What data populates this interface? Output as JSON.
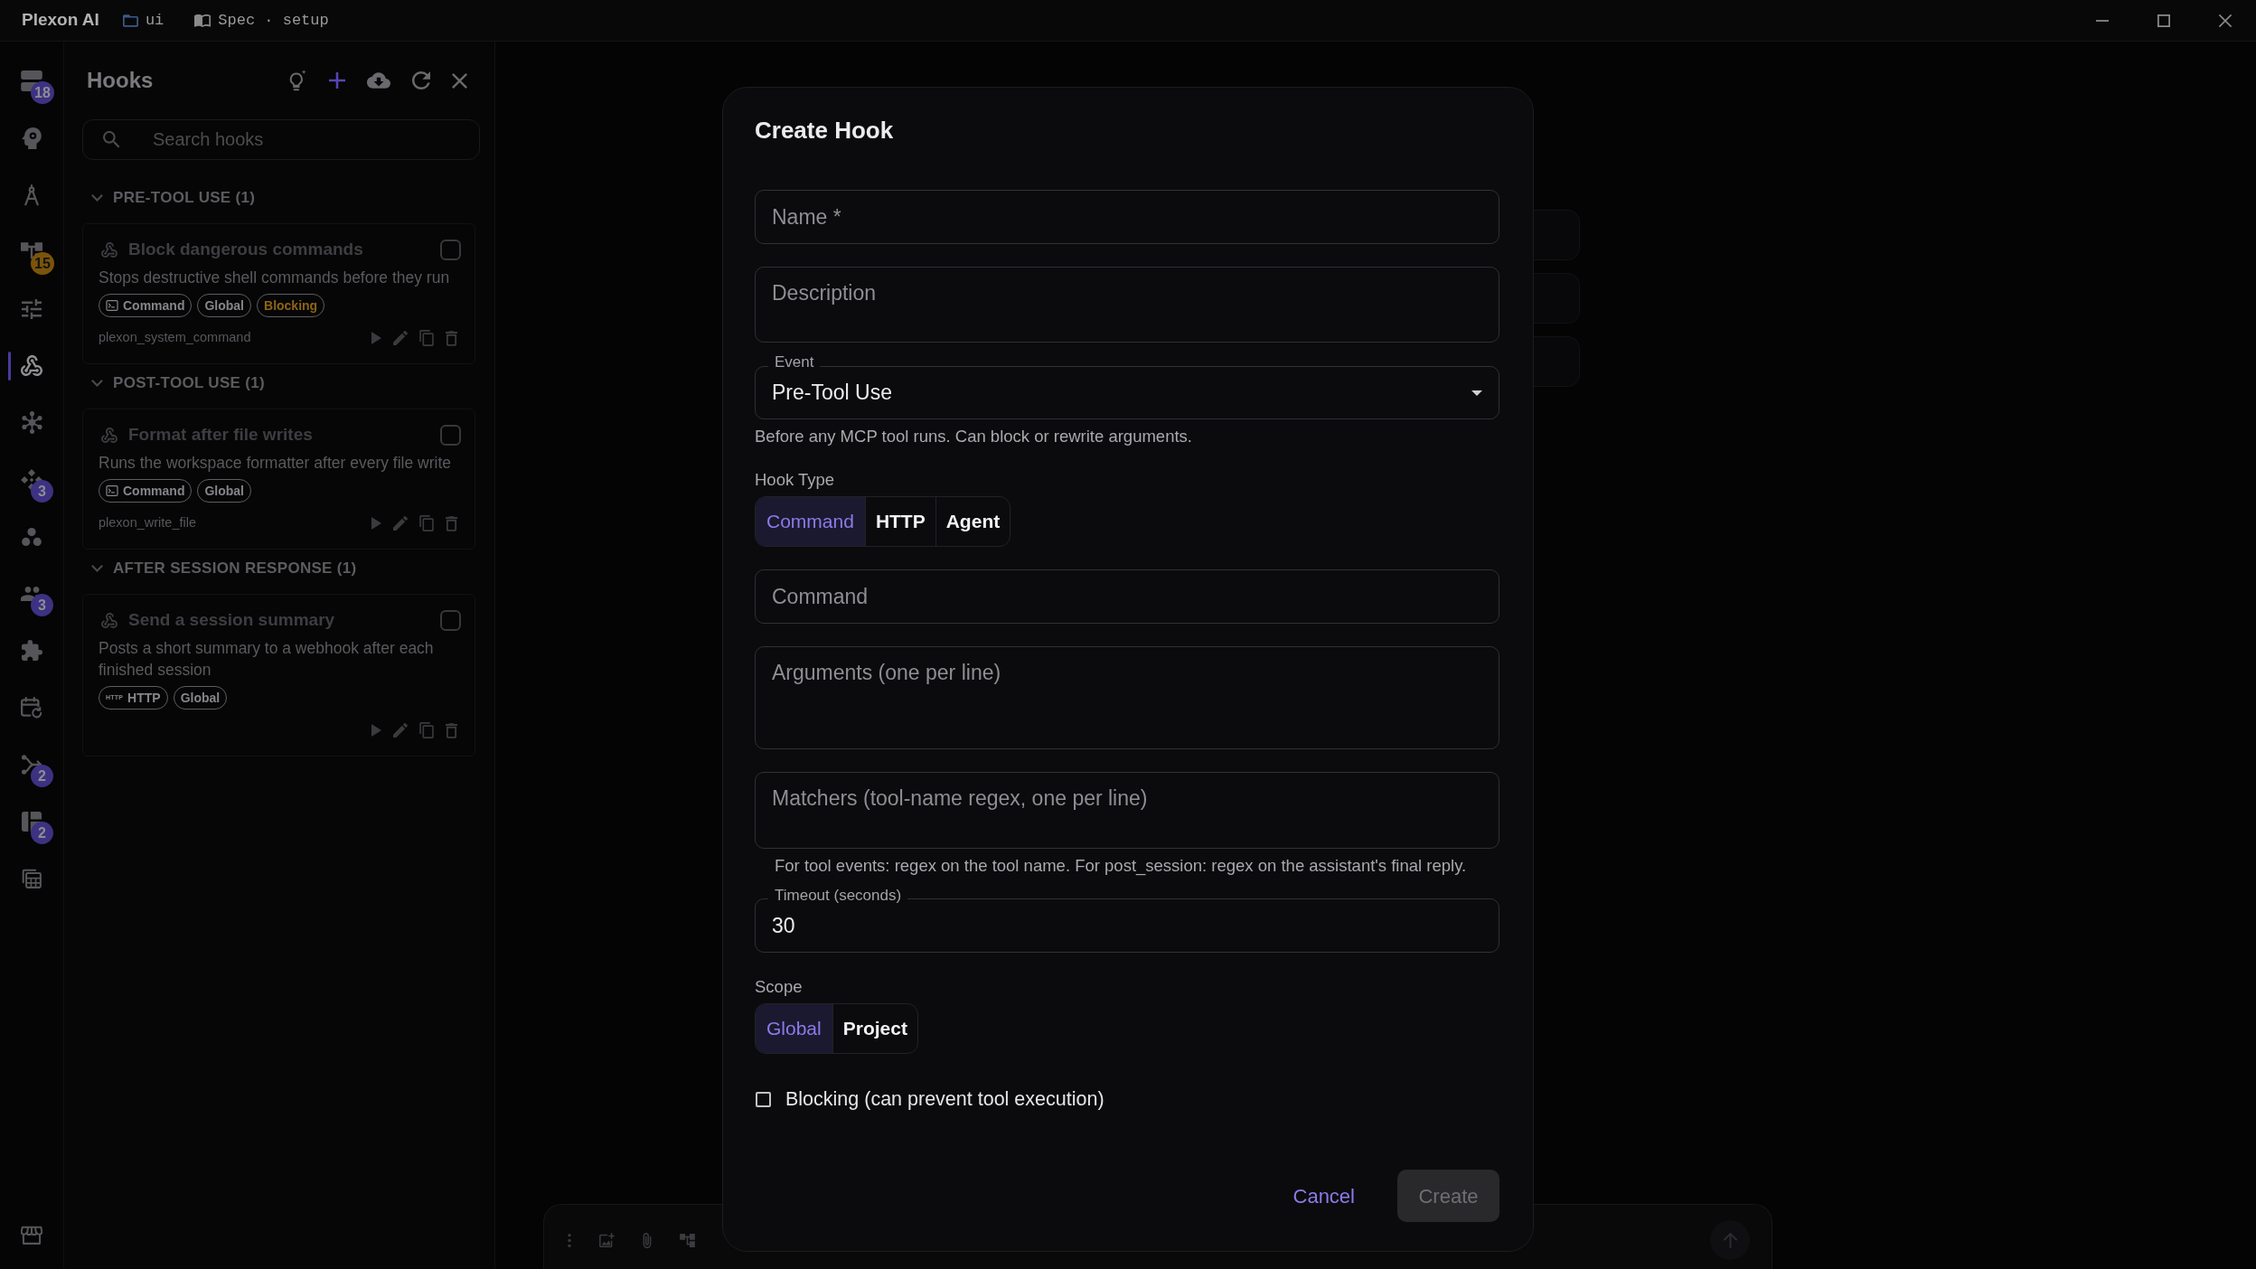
{
  "title_bar": {
    "app_name": "Plexon AI",
    "workspace": "ui",
    "document": "Spec · setup"
  },
  "rail": {
    "items": [
      {
        "selected": false,
        "badge": {
          "text": "18",
          "color": "#3d3182"
        }
      },
      {
        "selected": false
      },
      {
        "selected": false
      },
      {
        "selected": false,
        "badge": {
          "text": "15",
          "color": "#7b5409"
        }
      },
      {
        "selected": false
      },
      {
        "selected": true
      },
      {
        "selected": false
      },
      {
        "selected": false,
        "badge": {
          "text": "3",
          "color": "#3d3182"
        }
      },
      {
        "selected": false
      },
      {
        "selected": false,
        "badge": {
          "text": "3",
          "color": "#3d3182"
        }
      },
      {
        "selected": false
      },
      {
        "selected": false
      },
      {
        "selected": false,
        "badge": {
          "text": "2",
          "color": "#3d3182"
        }
      },
      {
        "selected": false,
        "badge": {
          "text": "2",
          "color": "#3d3182"
        }
      },
      {
        "selected": false
      }
    ],
    "footer_items": [
      {
        "selected": false
      }
    ]
  },
  "hooks_panel": {
    "title": "Hooks",
    "search": {
      "placeholder": "Search hooks"
    },
    "groups": [
      {
        "title": "PRE-TOOL USE (1)",
        "expanded": true,
        "hooks": [
          {
            "name": "Block dangerous commands",
            "enabled": false,
            "description": "Stops destructive shell commands before they run",
            "tags": [
              {
                "kind": "command",
                "label": "Command"
              },
              {
                "kind": "scope",
                "label": "Global"
              },
              {
                "kind": "blocking",
                "label": "Blocking"
              }
            ],
            "tool": "plexon_system_command"
          }
        ]
      },
      {
        "title": "POST-TOOL USE (1)",
        "expanded": true,
        "hooks": [
          {
            "name": "Format after file writes",
            "enabled": false,
            "description": "Runs the workspace formatter after every file write",
            "tags": [
              {
                "kind": "command",
                "label": "Command"
              },
              {
                "kind": "scope",
                "label": "Global"
              }
            ],
            "tool": "plexon_write_file"
          }
        ]
      },
      {
        "title": "AFTER SESSION RESPONSE (1)",
        "expanded": true,
        "hooks": [
          {
            "name": "Send a session summary",
            "enabled": false,
            "description": "Posts a short summary to a webhook after each finished session",
            "tags": [
              {
                "kind": "http",
                "label": "HTTP",
                "glyph": "HTTP"
              },
              {
                "kind": "scope",
                "label": "Global"
              }
            ]
          }
        ]
      }
    ]
  },
  "dialog": {
    "title": "Create Hook",
    "fields": [
      {
        "kind": "input",
        "placeholder": "Name *"
      },
      {
        "kind": "textarea",
        "placeholder": "Description"
      },
      {
        "kind": "select",
        "label": "Event",
        "value": "Pre-Tool Use",
        "helper": "Before any MCP tool runs. Can block or rewrite arguments."
      },
      {
        "kind": "segmented",
        "label": "Hook Type",
        "options": [
          {
            "label": "Command",
            "selected": true
          },
          {
            "label": "HTTP",
            "selected": false
          },
          {
            "label": "Agent",
            "selected": false
          }
        ]
      },
      {
        "kind": "input",
        "placeholder": "Command"
      },
      {
        "kind": "textarea",
        "placeholder": "Arguments (one per line)"
      },
      {
        "kind": "textarea",
        "placeholder": "Matchers (tool-name regex, one per line)",
        "helper": "For tool events: regex on the tool name. For post_session: regex on the assistant's final reply."
      },
      {
        "kind": "number",
        "label": "Timeout (seconds)",
        "value": "30"
      },
      {
        "kind": "segmented",
        "label": "Scope",
        "options": [
          {
            "label": "Global",
            "selected": true
          },
          {
            "label": "Project",
            "selected": false
          }
        ]
      },
      {
        "kind": "checkbox",
        "label": "Blocking (can prevent tool execution)",
        "checked": false
      }
    ],
    "actions": [
      {
        "kind": "text",
        "label": "Cancel",
        "disabled": false
      },
      {
        "kind": "contained",
        "label": "Create",
        "disabled": true
      }
    ]
  }
}
